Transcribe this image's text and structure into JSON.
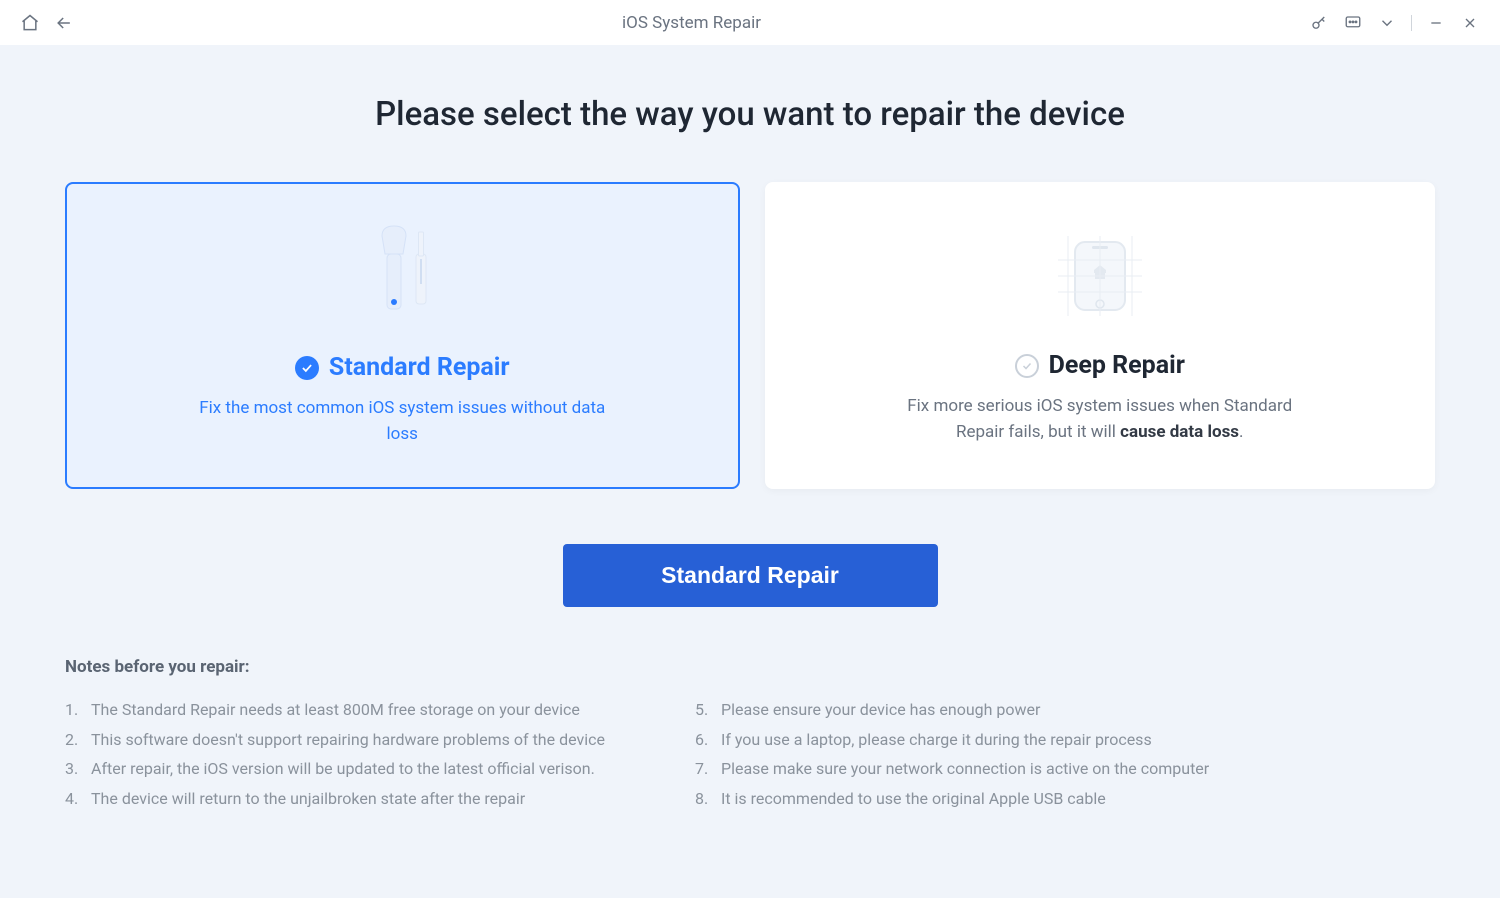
{
  "titlebar": {
    "title": "iOS System Repair"
  },
  "heading": "Please select the way you want to repair the device",
  "cards": {
    "standard": {
      "title": "Standard Repair",
      "desc": "Fix the most common iOS system issues without data loss"
    },
    "deep": {
      "title": "Deep Repair",
      "desc_prefix": "Fix more serious iOS system issues when Standard Repair fails, but it will ",
      "desc_bold": "cause data loss",
      "desc_suffix": "."
    }
  },
  "button": {
    "label": "Standard Repair"
  },
  "notes": {
    "title": "Notes before you repair:",
    "left": [
      {
        "n": "1.",
        "t": "The Standard Repair needs at least 800M free storage on your device"
      },
      {
        "n": "2.",
        "t": "This software doesn't support repairing hardware problems of the device"
      },
      {
        "n": "3.",
        "t": "After repair, the iOS version will be updated to the latest official verison."
      },
      {
        "n": "4.",
        "t": "The device will return to the unjailbroken state after the repair"
      }
    ],
    "right": [
      {
        "n": "5.",
        "t": "Please ensure your device has enough power"
      },
      {
        "n": "6.",
        "t": "If you use a laptop, please charge it during the repair process"
      },
      {
        "n": "7.",
        "t": "Please make sure your network connection is active on the computer"
      },
      {
        "n": "8.",
        "t": "It is recommended to use the original Apple USB cable"
      }
    ]
  }
}
